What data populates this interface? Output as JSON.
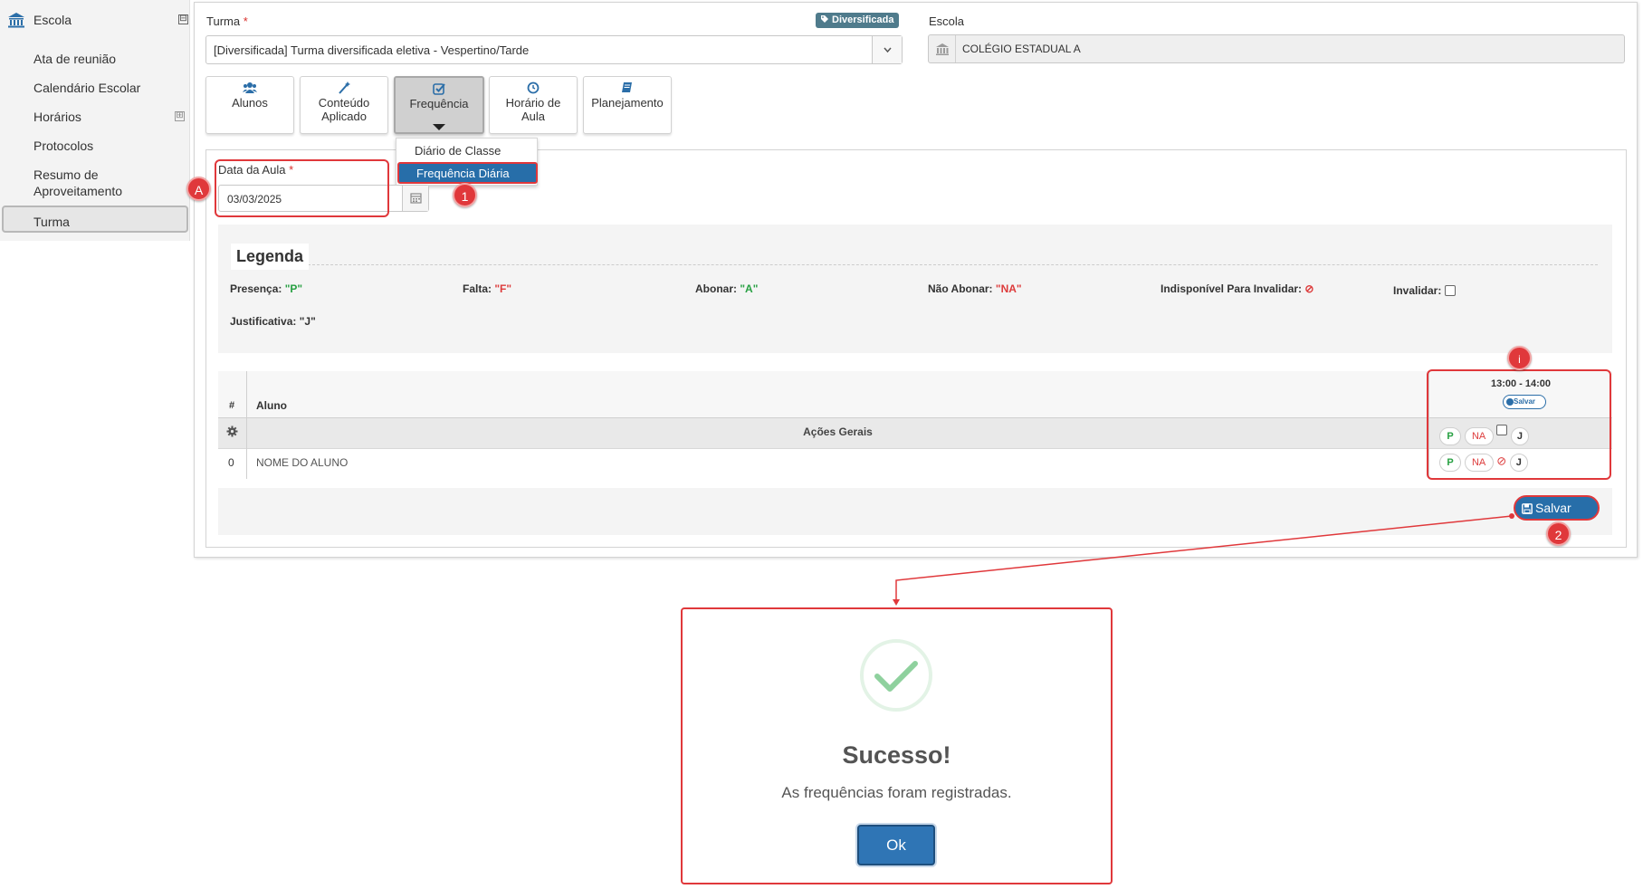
{
  "sidebar": {
    "title": "Escola",
    "collapse_symbol": "⊟",
    "items": [
      {
        "label": "Ata de reunião"
      },
      {
        "label": "Calendário Escolar"
      },
      {
        "label": "Horários"
      },
      {
        "label": "Protocolos"
      },
      {
        "label": "Resumo de Aproveitamento"
      },
      {
        "label": "Turma",
        "active": true
      }
    ],
    "expand_symbol": "⊞",
    "icon": "bank-icon"
  },
  "form": {
    "turma_label": "Turma",
    "required_mark": "*",
    "badge": "Diversificada",
    "turma_value": "[Diversificada]  Turma diversificada eletiva - Vespertino/Tarde",
    "escola_label": "Escola",
    "escola_value": "COLÉGIO ESTADUAL A"
  },
  "tabs": [
    {
      "label": "Alunos",
      "icon": "users-icon"
    },
    {
      "label": "Conteúdo Aplicado",
      "icon": "magic-wand-icon"
    },
    {
      "label": "Frequência",
      "icon": "checkbox-icon",
      "active": true
    },
    {
      "label": "Horário de Aula",
      "icon": "clock-icon"
    },
    {
      "label": "Planejamento",
      "icon": "book-icon"
    }
  ],
  "dropdown": {
    "items": [
      "Diário de Classe",
      "Frequência Diária"
    ],
    "selected": "Frequência Diária"
  },
  "date": {
    "label": "Data da Aula",
    "value": "03/03/2025"
  },
  "legend": {
    "title": "Legenda",
    "items": [
      {
        "label": "Presença:",
        "code": "\"P\""
      },
      {
        "label": "Falta:",
        "code": "\"F\""
      },
      {
        "label": "Abonar:",
        "code": "\"A\""
      },
      {
        "label": "Não Abonar:",
        "code": "\"NA\""
      },
      {
        "label": "Indisponível Para Invalidar:",
        "code": "⊘"
      },
      {
        "label": "Invalidar:",
        "code": ""
      },
      {
        "label": "Justificativa:",
        "code": "\"J\""
      }
    ]
  },
  "table": {
    "col_num": "#",
    "col_aluno": "Aluno",
    "time_slot": "13:00 - 14:00",
    "slot_save": "Salvar",
    "acoes_gerais": "Ações Gerais",
    "row_index": "0",
    "row_name": "NOME DO ALUNO",
    "btn_p": "P",
    "btn_na": "NA",
    "btn_j": "J",
    "unavailable": "⊘"
  },
  "save_button": "Salvar",
  "markers": {
    "a": "A",
    "one": "1",
    "info": "i",
    "two": "2"
  },
  "modal": {
    "title": "Sucesso!",
    "message": "As frequências foram registradas.",
    "ok": "Ok"
  },
  "colors": {
    "primary": "#276ea9",
    "highlight": "#e0383b",
    "success": "#8fd19e",
    "green_code": "#27a042",
    "red_code": "#dd3b3b"
  }
}
